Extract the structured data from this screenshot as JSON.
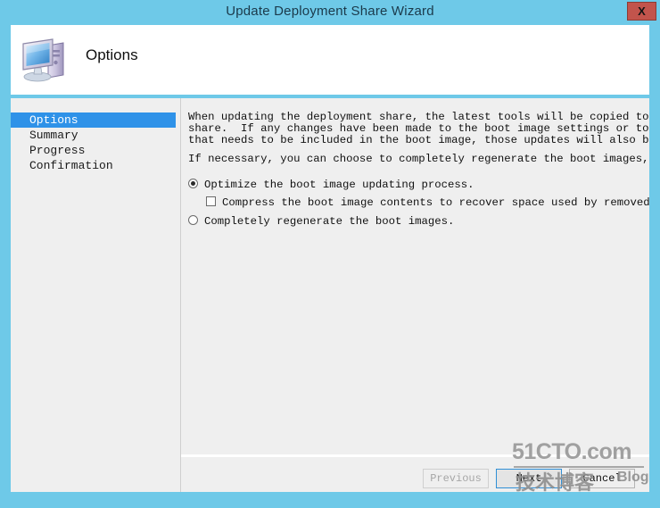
{
  "window": {
    "title": "Update Deployment Share Wizard",
    "close_label": "X",
    "frame_color": "#6ec9e8",
    "titlebar_color": "#6ec9e8",
    "close_button_color": "#c2544c"
  },
  "header": {
    "title": "Options",
    "icon": "computer-icon"
  },
  "sidebar": {
    "selected_index": 0,
    "highlight_color": "#2f92e8",
    "items": [
      {
        "label": "Options"
      },
      {
        "label": "Summary"
      },
      {
        "label": "Progress"
      },
      {
        "label": "Confirmation"
      }
    ]
  },
  "content": {
    "paragraph1": "When updating the deployment share, the latest tools will be copied to the deployment\nshare.  If any changes have been made to the boot image settings or to the content\nthat needs to be included in the boot image, those updates will also be made.",
    "paragraph2": "If necessary, you can choose to completely regenerate the boot images, or to compress",
    "options": {
      "optimize": {
        "label": "Optimize the boot image updating process.",
        "checked": true,
        "type": "radio"
      },
      "compress": {
        "label": "Compress the boot image contents to recover space used by removed or modified co",
        "checked": false,
        "type": "checkbox"
      },
      "regenerate": {
        "label": "Completely regenerate the boot images.",
        "checked": false,
        "type": "radio"
      }
    }
  },
  "footer": {
    "previous_label": "Previous",
    "previous_disabled": true,
    "next_label": "Next",
    "next_focused": true,
    "cancel_label": "Cancel"
  },
  "watermark": {
    "main": "51CTO.com",
    "chinese": "技术博客",
    "blog": "Blog"
  }
}
